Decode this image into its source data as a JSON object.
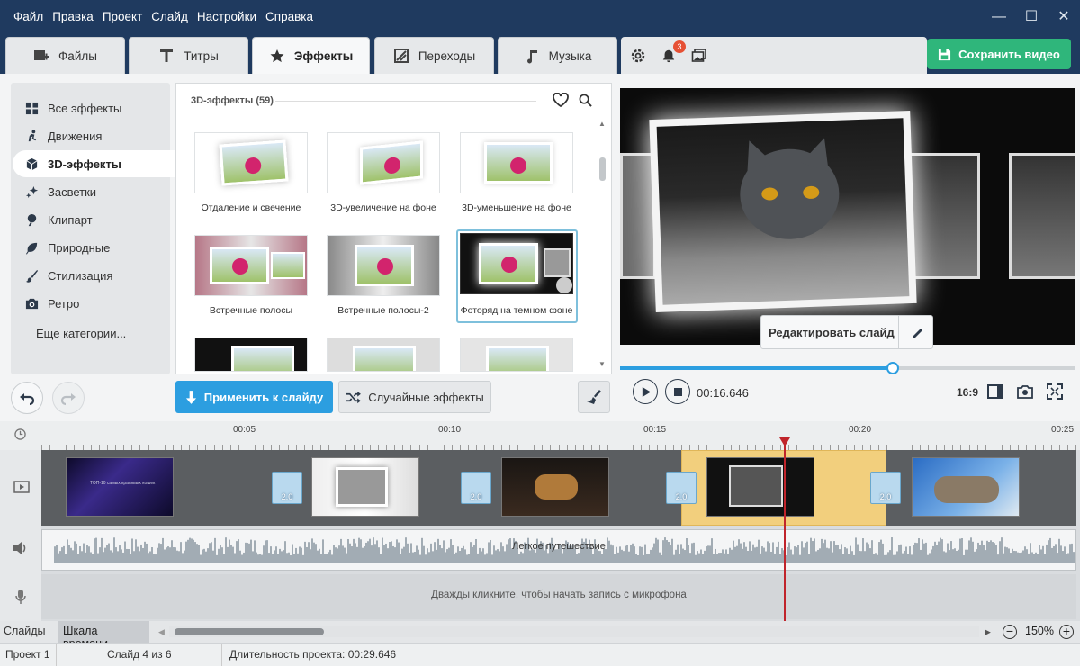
{
  "menu": [
    "Файл",
    "Правка",
    "Проект",
    "Слайд",
    "Настройки",
    "Справка"
  ],
  "tabs": [
    {
      "label": "Файлы",
      "icon": "add-media-icon"
    },
    {
      "label": "Титры",
      "icon": "text-icon"
    },
    {
      "label": "Эффекты",
      "icon": "star-icon"
    },
    {
      "label": "Переходы",
      "icon": "transition-icon"
    },
    {
      "label": "Музыка",
      "icon": "music-note-icon"
    }
  ],
  "toolbar": {
    "notifications_count": "3",
    "save_label": "Сохранить видео"
  },
  "categories": [
    {
      "label": "Все эффекты",
      "icon": "grid-icon"
    },
    {
      "label": "Движения",
      "icon": "running-icon"
    },
    {
      "label": "3D-эффекты",
      "icon": "cube-icon"
    },
    {
      "label": "Засветки",
      "icon": "sparkle-icon"
    },
    {
      "label": "Клипарт",
      "icon": "clipart-icon"
    },
    {
      "label": "Природные",
      "icon": "leaf-icon"
    },
    {
      "label": "Стилизация",
      "icon": "brush-icon"
    },
    {
      "label": "Ретро",
      "icon": "camera-icon"
    }
  ],
  "more_categories": "Еще категории...",
  "effects": {
    "heading": "3D-эффекты (59)",
    "items": [
      "Отдаление и свечение",
      "3D-увеличение на фоне",
      "3D-уменьшение на фоне",
      "Встречные полосы",
      "Встречные полосы-2",
      "Фоторяд на темном фоне"
    ],
    "selected_index": 5
  },
  "actions": {
    "apply": "Применить к слайду",
    "random": "Случайные эффекты"
  },
  "preview": {
    "edit_slide": "Редактировать слайд",
    "time": "00:16.646",
    "aspect": "16:9",
    "progress": 0.6
  },
  "ruler": [
    "00:05",
    "00:10",
    "00:15",
    "00:20",
    "00:25"
  ],
  "transitions": [
    "2.0",
    "2.0",
    "2.0",
    "2.0"
  ],
  "title_clip_text": "ТОП-10 самых красивых кошек",
  "audio": {
    "track_name": "Легкое путешествие",
    "mic_hint": "Дважды кликните, чтобы начать запись с микрофона"
  },
  "bottom": {
    "tab_slides": "Слайды",
    "tab_timeline": "Шкала времени",
    "zoom": "150%"
  },
  "status": {
    "project": "Проект 1",
    "slide": "Слайд 4 из 6",
    "duration": "Длительность проекта: 00:29.646"
  },
  "colors": {
    "titlebar": "#1f3a5f",
    "accent_green": "#2fb67b",
    "accent_blue": "#2c9ee0",
    "playhead": "#c0242b",
    "selected_clip": "#f2cf7d"
  }
}
